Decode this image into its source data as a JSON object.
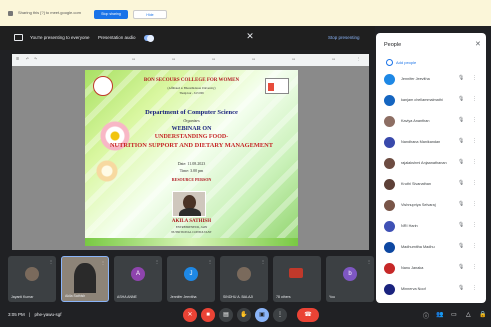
{
  "banner": {
    "message": "Sharing this [?] to meet.google.com",
    "stop_label": "Stop sharing",
    "hide_label": "Hide"
  },
  "presenting": {
    "text": "You're presenting to everyone",
    "audio_label": "Presentation audio",
    "stop_label": "Stop presenting"
  },
  "slide": {
    "college": "BON SECOURS COLLEGE FOR WOMEN",
    "addr1": "(Affiliated to Bharathidasan University)",
    "addr2": "Thanjavur - 613 006",
    "dept": "Department of Computer Science",
    "org": "Organizes",
    "webinar": "WEBINAR ON",
    "topic1": "UNDERSTANDING FOOD-",
    "topic2": "NUTRITION SUPPORT AND DIETARY MANAGEMENT",
    "date": "Date: 11.08.2023",
    "time": "Time: 3.00 pm",
    "resource": "RESOURCE PERSON",
    "rp_name": "AKILA SATHISH",
    "rp_role1": "ENTREPRENEUR, JAIN",
    "rp_role2": "NUTRITIONAL CONSULTANT"
  },
  "tiles": [
    {
      "name": "Jayanti Kumar",
      "type": "photo"
    },
    {
      "name": "Akila Sathish",
      "type": "highlight"
    },
    {
      "name": "ASHA ANNE",
      "type": "letter",
      "letter": "A",
      "color": "#8e44ad"
    },
    {
      "name": "Jennifer Jeevitha",
      "type": "letter",
      "letter": "J",
      "color": "#1e88e5"
    },
    {
      "name": "SINDHU A. BALAJI",
      "type": "photo"
    },
    {
      "name": "78 others",
      "type": "yt"
    },
    {
      "name": "You",
      "type": "letter",
      "letter": "b",
      "color": "#7e57c2"
    }
  ],
  "people": {
    "title": "People",
    "add_label": "Add people",
    "list": [
      {
        "name": "Jennifer Jeevitha",
        "color": "#1e88e5"
      },
      {
        "name": "kanjam chellammalmathi",
        "color": "#1565c0"
      },
      {
        "name": "Kaviya Ananthan",
        "color": "#8d6e63"
      },
      {
        "name": "Nandhana Manikandan",
        "color": "#3949ab"
      },
      {
        "name": "rajalakshmi Anjaanathanan",
        "color": "#6d4c41"
      },
      {
        "name": "Kruthi Sivanathan",
        "color": "#5d4037"
      },
      {
        "name": "Vishnupriya Selvaraj",
        "color": "#795548"
      },
      {
        "name": "NRI Harin",
        "color": "#3f51b5"
      },
      {
        "name": "Madhumitha Madhu",
        "color": "#0d47a1"
      },
      {
        "name": "Nanu Janaka",
        "color": "#c62828"
      },
      {
        "name": "Minnerva Noof",
        "color": "#1a237e"
      }
    ]
  },
  "bottom": {
    "time": "3:05 PM",
    "meeting_code": "phe-yawu-sgf"
  }
}
